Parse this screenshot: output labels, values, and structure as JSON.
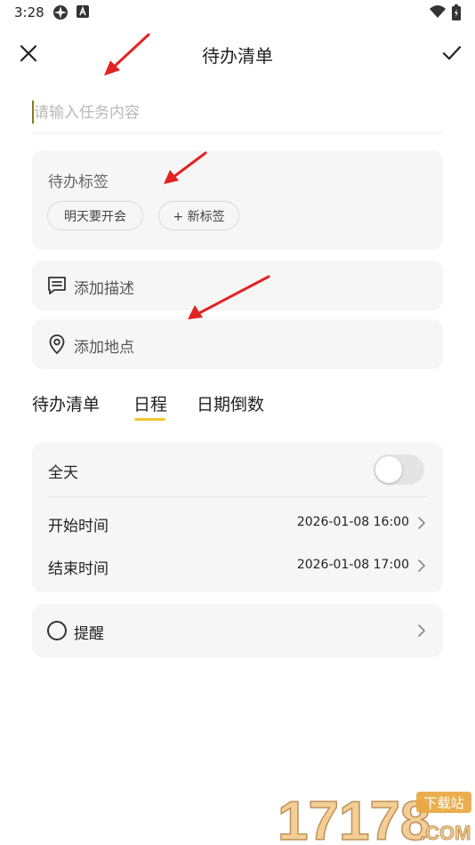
{
  "status_bar": {
    "time": "3:28"
  },
  "header": {
    "title": "待办清单"
  },
  "task_input": {
    "placeholder": "请输入任务内容"
  },
  "tags": {
    "title": "待办标签",
    "chips": [
      "明天要开会",
      "+ 新标签"
    ]
  },
  "description": {
    "label": "添加描述"
  },
  "location": {
    "label": "添加地点"
  },
  "tabs": [
    {
      "label": "待办清单",
      "active": false
    },
    {
      "label": "日程",
      "active": true
    },
    {
      "label": "日期倒数",
      "active": false
    }
  ],
  "schedule": {
    "all_day_label": "全天",
    "all_day_on": false,
    "start_label": "开始时间",
    "start_value": "2026-01-08 16:00",
    "end_label": "结束时间",
    "end_value": "2026-01-08 17:00"
  },
  "reminder": {
    "label": "提醒"
  },
  "colors": {
    "accent": "#f4c430",
    "card_bg": "#f6f6f6",
    "arrow": "#e32222"
  },
  "watermark": {
    "brand": "17178",
    "tag": "下载站",
    "suffix": ".COM"
  }
}
